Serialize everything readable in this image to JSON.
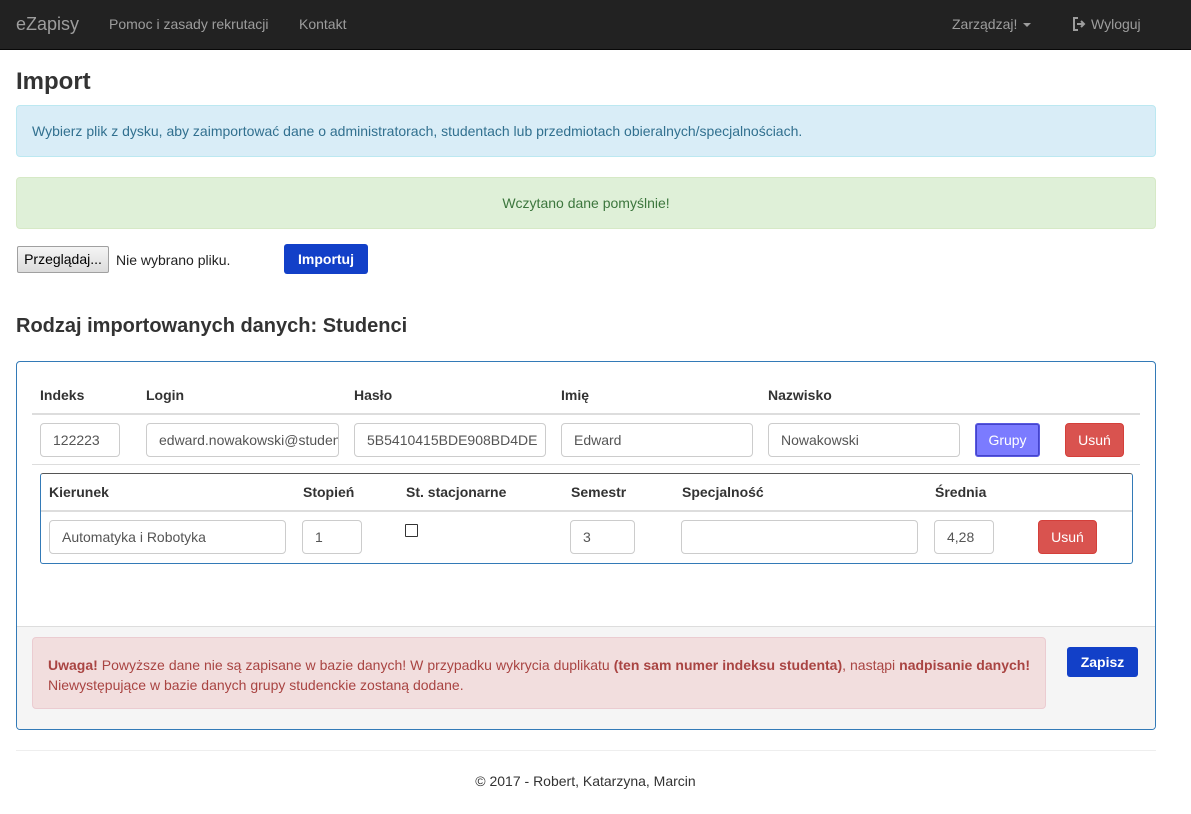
{
  "navbar": {
    "brand": "eZapisy",
    "links": [
      "Pomoc i zasady rekrutacji",
      "Kontakt"
    ],
    "manage": "Zarządzaj!",
    "logout": "Wyloguj"
  },
  "page": {
    "title": "Import",
    "info": "Wybierz plik z dysku, aby zaimportować dane o administratorach, studentach lub przedmiotach obieralnych/specjalnościach.",
    "success": "Wczytano dane pomyślnie!",
    "browse_label": "Przeglądaj...",
    "file_status": "Nie wybrano pliku.",
    "import_label": "Importuj",
    "section_title": "Rodzaj importowanych danych: Studenci"
  },
  "student_table": {
    "headers": [
      "Indeks",
      "Login",
      "Hasło",
      "Imię",
      "Nazwisko"
    ],
    "row": {
      "index": "122223",
      "login": "edward.nowakowski@student.pwr.edu.pl",
      "password": "5B5410415BDE908BD4DE",
      "first_name": "Edward",
      "last_name": "Nowakowski"
    },
    "groups_label": "Grupy",
    "remove_label": "Usuń"
  },
  "study_table": {
    "headers": [
      "Kierunek",
      "Stopień",
      "St. stacjonarne",
      "Semestr",
      "Specjalność",
      "Średnia"
    ],
    "row": {
      "field": "Automatyka i Robotyka",
      "degree": "1",
      "full_time": false,
      "semester": "3",
      "specialization": "",
      "average": "4,28"
    },
    "remove_label": "Usuń"
  },
  "warning": {
    "p1": "Uwaga!",
    "p2": " Powyższe dane nie są zapisane w bazie danych! W przypadku wykrycia duplikatu ",
    "p3": "(ten sam numer indeksu studenta)",
    "p4": ", nastąpi ",
    "p5": "nadpisanie danych!",
    "p6": " Niewystępujące w bazie danych grupy studenckie zostaną dodane."
  },
  "save_label": "Zapisz",
  "footer": "© 2017 - Robert, Katarzyna, Marcin"
}
